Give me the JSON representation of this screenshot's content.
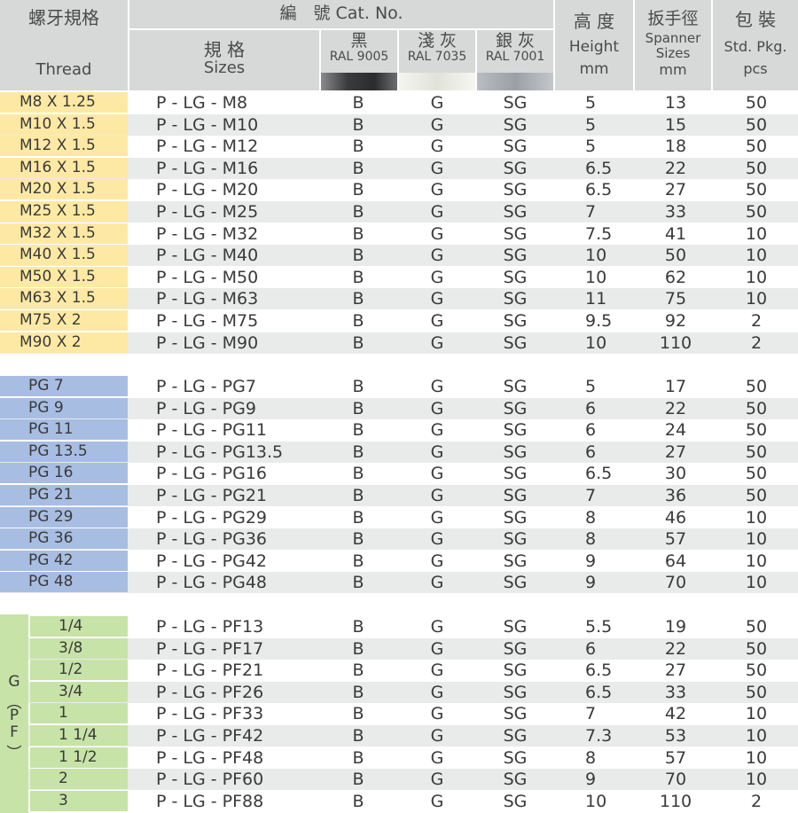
{
  "header": {
    "thread_cn": "螺牙規格",
    "thread_en": "Thread",
    "catno": "編　號  Cat. No.",
    "sizes_cn": "規 格",
    "sizes_en": "Sizes",
    "black_cn": "黑",
    "black_ral": "RAL 9005",
    "lgray_cn": "淺 灰",
    "lgray_ral": "RAL 7035",
    "sgray_cn": "銀 灰",
    "sgray_ral": "RAL 7001",
    "height_cn": "高 度",
    "height_en": "Height",
    "height_unit": "mm",
    "spanner_cn": "扳手徑",
    "spanner_en1": "Spanner",
    "spanner_en2": "Sizes",
    "spanner_unit": "mm",
    "pkg_cn": "包 裝",
    "pkg_en": "Std. Pkg.",
    "pkg_unit": "pcs"
  },
  "colors": {
    "header_bg": "#d7d8d8",
    "metric_label": "#fde9a3",
    "pg_label": "#a8bde2",
    "pf_label": "#c7e3a7",
    "row_alt": "#e9eaea"
  },
  "metric_rows": [
    {
      "thread": "M8   X 1.25",
      "cat": "P - LG - M8",
      "b": "B",
      "g": "G",
      "sg": "SG",
      "h": "5",
      "sp": "13",
      "pk": "50"
    },
    {
      "thread": "M10 X 1.5",
      "cat": "P - LG - M10",
      "b": "B",
      "g": "G",
      "sg": "SG",
      "h": "5",
      "sp": "15",
      "pk": "50"
    },
    {
      "thread": "M12 X 1.5",
      "cat": "P - LG - M12",
      "b": "B",
      "g": "G",
      "sg": "SG",
      "h": "5",
      "sp": "18",
      "pk": "50"
    },
    {
      "thread": "M16 X 1.5",
      "cat": "P - LG - M16",
      "b": "B",
      "g": "G",
      "sg": "SG",
      "h": "6.5",
      "sp": "22",
      "pk": "50"
    },
    {
      "thread": "M20 X 1.5",
      "cat": "P - LG - M20",
      "b": "B",
      "g": "G",
      "sg": "SG",
      "h": "6.5",
      "sp": "27",
      "pk": "50"
    },
    {
      "thread": "M25 X 1.5",
      "cat": "P - LG - M25",
      "b": "B",
      "g": "G",
      "sg": "SG",
      "h": "7",
      "sp": "33",
      "pk": "50"
    },
    {
      "thread": "M32 X 1.5",
      "cat": "P - LG - M32",
      "b": "B",
      "g": "G",
      "sg": "SG",
      "h": "7.5",
      "sp": "41",
      "pk": "10"
    },
    {
      "thread": "M40 X 1.5",
      "cat": "P - LG - M40",
      "b": "B",
      "g": "G",
      "sg": "SG",
      "h": "10",
      "sp": "50",
      "pk": "10"
    },
    {
      "thread": "M50 X 1.5",
      "cat": "P - LG - M50",
      "b": "B",
      "g": "G",
      "sg": "SG",
      "h": "10",
      "sp": "62",
      "pk": "10"
    },
    {
      "thread": "M63 X 1.5",
      "cat": "P - LG - M63",
      "b": "B",
      "g": "G",
      "sg": "SG",
      "h": "11",
      "sp": "75",
      "pk": "10"
    },
    {
      "thread": "M75 X 2",
      "cat": "P - LG - M75",
      "b": "B",
      "g": "G",
      "sg": "SG",
      "h": "9.5",
      "sp": "92",
      "pk": "2"
    },
    {
      "thread": "M90 X 2",
      "cat": "P - LG - M90",
      "b": "B",
      "g": "G",
      "sg": "SG",
      "h": "10",
      "sp": "110",
      "pk": "2"
    }
  ],
  "pg_rows": [
    {
      "thread": "PG 7",
      "cat": "P - LG - PG7",
      "b": "B",
      "g": "G",
      "sg": "SG",
      "h": "5",
      "sp": "17",
      "pk": "50"
    },
    {
      "thread": "PG 9",
      "cat": "P - LG - PG9",
      "b": "B",
      "g": "G",
      "sg": "SG",
      "h": "6",
      "sp": "22",
      "pk": "50"
    },
    {
      "thread": "PG 11",
      "cat": "P - LG - PG11",
      "b": "B",
      "g": "G",
      "sg": "SG",
      "h": "6",
      "sp": "24",
      "pk": "50"
    },
    {
      "thread": "PG 13.5",
      "cat": "P - LG - PG13.5",
      "b": "B",
      "g": "G",
      "sg": "SG",
      "h": "6",
      "sp": "27",
      "pk": "50"
    },
    {
      "thread": "PG 16",
      "cat": "P - LG - PG16",
      "b": "B",
      "g": "G",
      "sg": "SG",
      "h": "6.5",
      "sp": "30",
      "pk": "50"
    },
    {
      "thread": "PG 21",
      "cat": "P - LG - PG21",
      "b": "B",
      "g": "G",
      "sg": "SG",
      "h": "7",
      "sp": "36",
      "pk": "50"
    },
    {
      "thread": "PG 29",
      "cat": "P - LG - PG29",
      "b": "B",
      "g": "G",
      "sg": "SG",
      "h": "8",
      "sp": "46",
      "pk": "10"
    },
    {
      "thread": "PG 36",
      "cat": "P - LG - PG36",
      "b": "B",
      "g": "G",
      "sg": "SG",
      "h": "8",
      "sp": "57",
      "pk": "10"
    },
    {
      "thread": "PG 42",
      "cat": "P - LG - PG42",
      "b": "B",
      "g": "G",
      "sg": "SG",
      "h": "9",
      "sp": "64",
      "pk": "10"
    },
    {
      "thread": "PG 48",
      "cat": "P - LG - PG48",
      "b": "B",
      "g": "G",
      "sg": "SG",
      "h": "9",
      "sp": "70",
      "pk": "10"
    }
  ],
  "pf_group_label": [
    "G",
    "︵",
    "P",
    "F",
    "︶"
  ],
  "pf_rows": [
    {
      "thread": "1/4",
      "cat": "P - LG - PF13",
      "b": "B",
      "g": "G",
      "sg": "SG",
      "h": "5.5",
      "sp": "19",
      "pk": "50"
    },
    {
      "thread": "3/8",
      "cat": "P - LG - PF17",
      "b": "B",
      "g": "G",
      "sg": "SG",
      "h": "6",
      "sp": "22",
      "pk": "50"
    },
    {
      "thread": "1/2",
      "cat": "P - LG - PF21",
      "b": "B",
      "g": "G",
      "sg": "SG",
      "h": "6.5",
      "sp": "27",
      "pk": "50"
    },
    {
      "thread": "3/4",
      "cat": "P - LG - PF26",
      "b": "B",
      "g": "G",
      "sg": "SG",
      "h": "6.5",
      "sp": "33",
      "pk": "50"
    },
    {
      "thread": "1",
      "cat": "P - LG - PF33",
      "b": "B",
      "g": "G",
      "sg": "SG",
      "h": "7",
      "sp": "42",
      "pk": "10"
    },
    {
      "thread": "1 1/4",
      "cat": "P - LG - PF42",
      "b": "B",
      "g": "G",
      "sg": "SG",
      "h": "7.3",
      "sp": "53",
      "pk": "10"
    },
    {
      "thread": "1 1/2",
      "cat": "P - LG - PF48",
      "b": "B",
      "g": "G",
      "sg": "SG",
      "h": "8",
      "sp": "57",
      "pk": "10"
    },
    {
      "thread": "2",
      "cat": "P - LG - PF60",
      "b": "B",
      "g": "G",
      "sg": "SG",
      "h": "9",
      "sp": "70",
      "pk": "10"
    },
    {
      "thread": "3",
      "cat": "P - LG - PF88",
      "b": "B",
      "g": "G",
      "sg": "SG",
      "h": "10",
      "sp": "110",
      "pk": "2"
    }
  ]
}
